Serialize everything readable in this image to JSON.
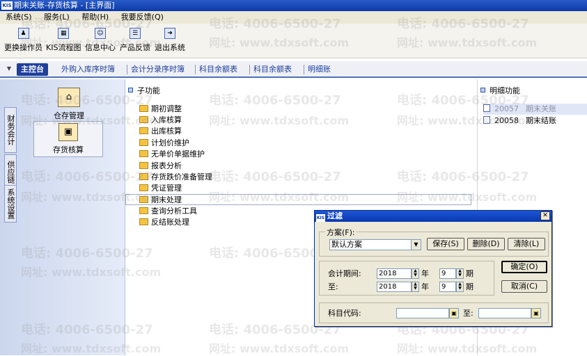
{
  "window": {
    "title": "期末关账-存货核算 - [主界面]",
    "logo": "KIS"
  },
  "menu": [
    "系统(S)",
    "服务(L)",
    "帮助(H)",
    "我要反馈(Q)"
  ],
  "toolbar": [
    {
      "label": "更换操作员",
      "icon": "switch-user-icon"
    },
    {
      "label": "KIS流程图",
      "icon": "flowchart-icon"
    },
    {
      "label": "信息中心",
      "icon": "info-center-icon"
    },
    {
      "label": "产品反馈",
      "icon": "feedback-icon"
    },
    {
      "label": "退出系统",
      "icon": "exit-icon"
    }
  ],
  "tabs": {
    "main": "主控台",
    "items": [
      "外购入库序时簿",
      "会计分录序时簿",
      "科目余额表",
      "科目余额表",
      "明细账"
    ]
  },
  "sidebar": {
    "vertical_tabs": [
      "财务会计",
      "供应链",
      "系统设置"
    ],
    "modules": [
      {
        "label": "仓存管理"
      },
      {
        "label": "存货核算"
      }
    ]
  },
  "subfunctions": {
    "header": "子功能",
    "items": [
      "期初调整",
      "入库核算",
      "出库核算",
      "计划价维护",
      "无单价单据维护",
      "报表分析",
      "存货跌价准备管理",
      "凭证管理",
      "期末处理",
      "查询分析工具",
      "反结账处理"
    ],
    "selected": "期末处理"
  },
  "details": {
    "header": "明细功能",
    "items": [
      {
        "code": "20057",
        "label": "期末关账"
      },
      {
        "code": "20058",
        "label": "期末结账"
      }
    ]
  },
  "watermark": {
    "phone": "电话: 4006-6500-27",
    "site": "网址: www.tdxsoft.com"
  },
  "dialog": {
    "title": "过滤",
    "logo": "KIS",
    "scheme_group": "方案(F):",
    "scheme_value": "默认方案",
    "save": "保存(S)",
    "delete": "删除(D)",
    "clear": "清除(L)",
    "ok": "确定(O)",
    "cancel": "取消(C)",
    "period_label": "会计期间:",
    "to_label": "至:",
    "year1": "2018",
    "month1": "9",
    "year2": "2018",
    "month2": "9",
    "year_unit": "年",
    "month_unit": "期",
    "subject_label": "科目代码:",
    "subject_to": "至:"
  },
  "colors": {
    "accent": "#1f3f9c",
    "titlebar": "#0b3aa8"
  }
}
